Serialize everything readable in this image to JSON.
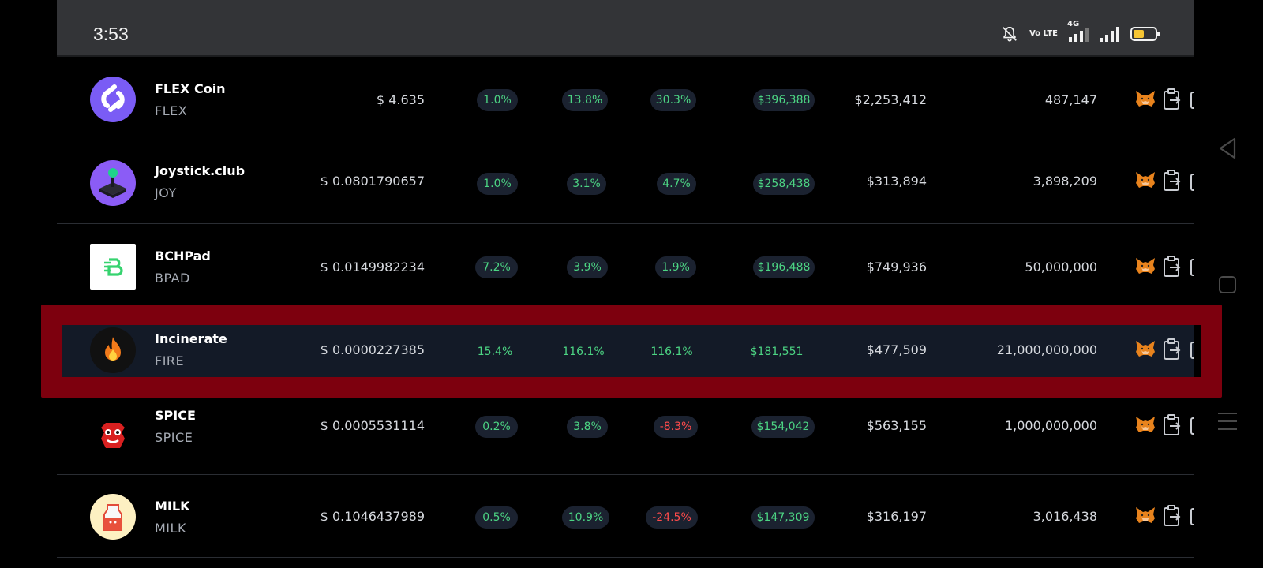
{
  "status_bar": {
    "time": "3:53",
    "network": "4G",
    "volte": "Vo LTE"
  },
  "tokens": [
    {
      "name": "FLEX Coin",
      "symbol": "FLEX",
      "price": "$ 4.635",
      "change_1h": "1.0%",
      "change_24h": "13.8%",
      "change_7d": "30.3%",
      "volume": "$396,388",
      "market_cap": "$2,253,412",
      "supply": "487,147",
      "logo": "flex-logo",
      "negative": [
        false,
        false,
        false
      ]
    },
    {
      "name": "Joystick.club",
      "symbol": "JOY",
      "price": "$ 0.0801790657",
      "change_1h": "1.0%",
      "change_24h": "3.1%",
      "change_7d": "4.7%",
      "volume": "$258,438",
      "market_cap": "$313,894",
      "supply": "3,898,209",
      "logo": "joystick-logo",
      "negative": [
        false,
        false,
        false
      ]
    },
    {
      "name": "BCHPad",
      "symbol": "BPAD",
      "price": "$ 0.0149982234",
      "change_1h": "7.2%",
      "change_24h": "3.9%",
      "change_7d": "1.9%",
      "volume": "$196,488",
      "market_cap": "$749,936",
      "supply": "50,000,000",
      "logo": "bchpad-logo",
      "negative": [
        false,
        false,
        false
      ]
    },
    {
      "name": "Incinerate",
      "symbol": "FIRE",
      "price": "$ 0.0000227385",
      "change_1h": "15.4%",
      "change_24h": "116.1%",
      "change_7d": "116.1%",
      "volume": "$181,551",
      "market_cap": "$477,509",
      "supply": "21,000,000,000",
      "logo": "fire-logo",
      "negative": [
        false,
        false,
        false
      ]
    },
    {
      "name": "SPICE",
      "symbol": "SPICE",
      "price": "$ 0.0005531114",
      "change_1h": "0.2%",
      "change_24h": "3.8%",
      "change_7d": "-8.3%",
      "volume": "$154,042",
      "market_cap": "$563,155",
      "supply": "1,000,000,000",
      "logo": "spice-logo",
      "negative": [
        false,
        false,
        true
      ]
    },
    {
      "name": "MILK",
      "symbol": "MILK",
      "price": "$ 0.1046437989",
      "change_1h": "0.5%",
      "change_24h": "10.9%",
      "change_7d": "-24.5%",
      "volume": "$147,309",
      "market_cap": "$316,197",
      "supply": "3,016,438",
      "logo": "milk-logo",
      "negative": [
        false,
        false,
        true
      ]
    }
  ],
  "colors": {
    "positive": "#4cd483",
    "negative": "#ff4b4b",
    "highlight_frame": "#7d000e",
    "row_highlight": "#131a27"
  }
}
